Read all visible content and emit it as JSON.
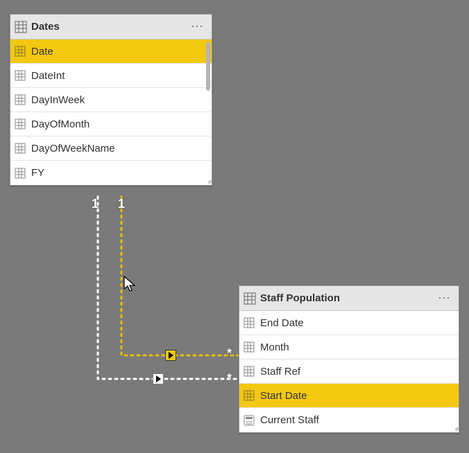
{
  "tables": {
    "dates": {
      "title": "Dates",
      "fields": [
        {
          "label": "Date",
          "icon": "table",
          "selected": true
        },
        {
          "label": "DateInt",
          "icon": "table",
          "selected": false
        },
        {
          "label": "DayInWeek",
          "icon": "table",
          "selected": false
        },
        {
          "label": "DayOfMonth",
          "icon": "table",
          "selected": false
        },
        {
          "label": "DayOfWeekName",
          "icon": "table",
          "selected": false
        },
        {
          "label": "FY",
          "icon": "table",
          "selected": false
        }
      ]
    },
    "staff": {
      "title": "Staff Population",
      "fields": [
        {
          "label": "End Date",
          "icon": "table",
          "selected": false
        },
        {
          "label": "Month",
          "icon": "table",
          "selected": false
        },
        {
          "label": "Staff Ref",
          "icon": "table",
          "selected": false
        },
        {
          "label": "Start Date",
          "icon": "table",
          "selected": true
        },
        {
          "label": "Current Staff",
          "icon": "calc",
          "selected": false
        }
      ]
    }
  },
  "rel": {
    "from1": "1",
    "from2": "1",
    "toStar1": "*",
    "toStar2": "*"
  }
}
